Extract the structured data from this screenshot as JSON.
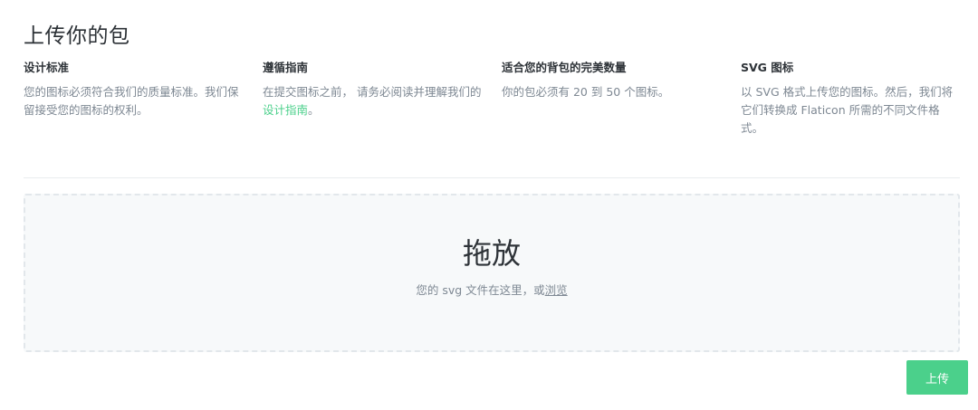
{
  "page": {
    "title": "上传你的包"
  },
  "guidelines": [
    {
      "title": "设计标准",
      "text": "您的图标必须符合我们的质量标准。我们保留接受您的图标的权利。"
    },
    {
      "title": "遵循指南",
      "text_before": "在提交图标之前， 请务必阅读并理解我们的",
      "link": "设计指南",
      "text_after": "。"
    },
    {
      "title": "适合您的背包的完美数量",
      "text": "你的包必须有 20 到 50 个图标。"
    },
    {
      "title": "SVG 图标",
      "text": "以 SVG 格式上传您的图标。然后，我们将它们转换成 Flaticon 所需的不同文件格式。"
    }
  ],
  "dropzone": {
    "title": "拖放",
    "subtitle_prefix": "您的 svg 文件在这里，或",
    "browse_link": "浏览"
  },
  "actions": {
    "upload_label": "上传"
  },
  "colors": {
    "accent": "#4bd08b",
    "muted_text": "#7e8893",
    "dropzone_bg": "#f7f9fa"
  }
}
